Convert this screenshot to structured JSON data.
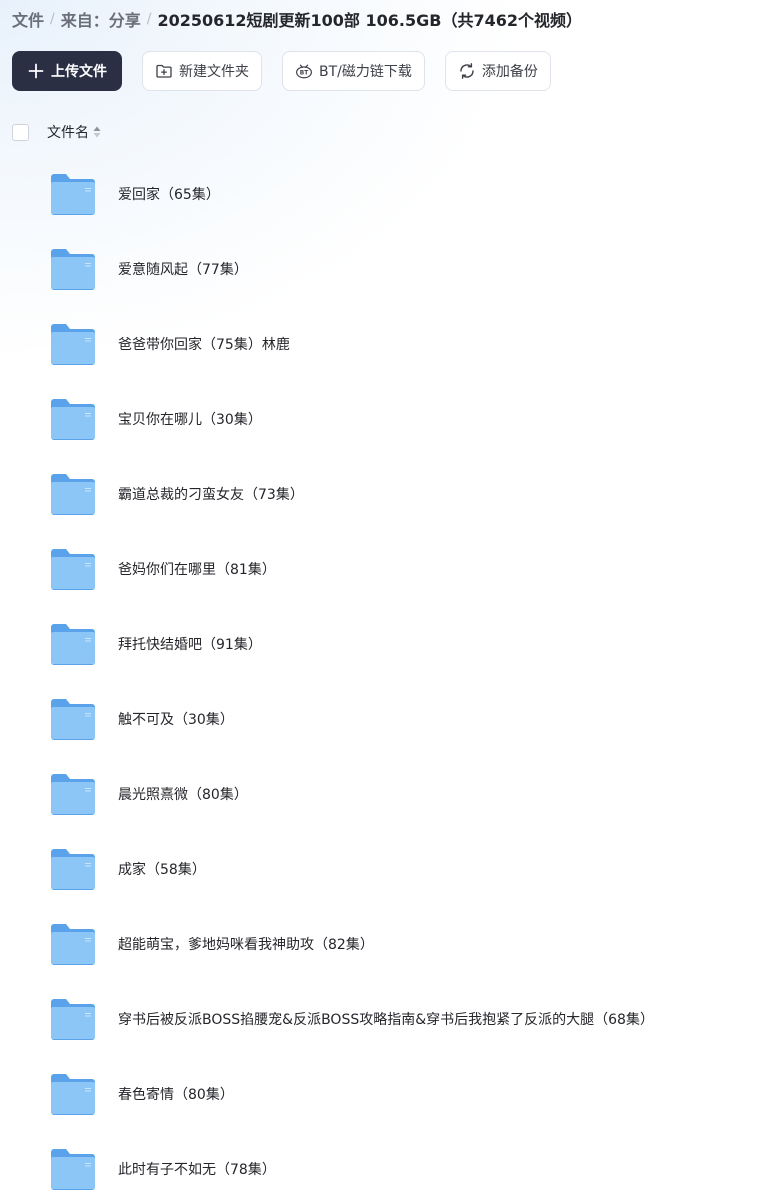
{
  "breadcrumb": {
    "root": "文件",
    "parent": "来自：分享",
    "current": "20250612短剧更新100部 106.5GB（共7462个视频）",
    "separator": "/"
  },
  "toolbar": {
    "upload_label": "上传文件",
    "upload_icon": "plus-icon",
    "new_folder_label": "新建文件夹",
    "new_folder_icon": "folder-plus-icon",
    "bt_label": "BT/磁力链下载",
    "bt_icon": "bt-icon",
    "backup_label": "添加备份",
    "backup_icon": "sync-icon"
  },
  "list_header": {
    "name_column": "文件名",
    "sort_icon": "sort-icon"
  },
  "colors": {
    "primary_button": "#2b2f44",
    "folder_back": "#5aa3ea",
    "folder_front": "#8cc6f7",
    "text": "#25262b"
  },
  "files": [
    {
      "name": "爱回家（65集）",
      "icon": "folder-icon"
    },
    {
      "name": "爱意随风起（77集）",
      "icon": "folder-icon"
    },
    {
      "name": "爸爸带你回家（75集）林鹿",
      "icon": "folder-icon"
    },
    {
      "name": "宝贝你在哪儿（30集）",
      "icon": "folder-icon"
    },
    {
      "name": "霸道总裁的刁蛮女友（73集）",
      "icon": "folder-icon"
    },
    {
      "name": "爸妈你们在哪里（81集）",
      "icon": "folder-icon"
    },
    {
      "name": "拜托快结婚吧（91集）",
      "icon": "folder-icon"
    },
    {
      "name": "触不可及（30集）",
      "icon": "folder-icon"
    },
    {
      "name": "晨光照熹微（80集）",
      "icon": "folder-icon"
    },
    {
      "name": "成家（58集）",
      "icon": "folder-icon"
    },
    {
      "name": "超能萌宝，爹地妈咪看我神助攻（82集）",
      "icon": "folder-icon"
    },
    {
      "name": "穿书后被反派BOSS掐腰宠&反派BOSS攻略指南&穿书后我抱紧了反派的大腿（68集）",
      "icon": "folder-icon"
    },
    {
      "name": "春色寄情（80集）",
      "icon": "folder-icon"
    },
    {
      "name": "此时有子不如无（78集）",
      "icon": "folder-icon"
    }
  ]
}
